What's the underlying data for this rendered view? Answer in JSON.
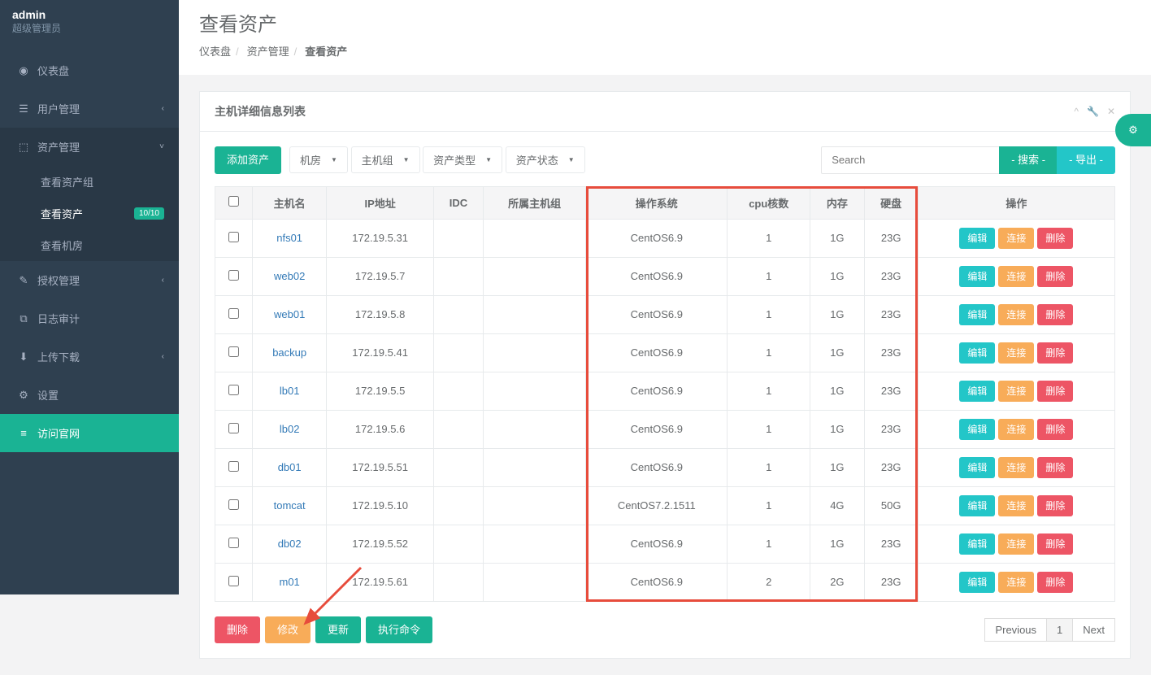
{
  "profile": {
    "name": "admin",
    "role": "超级管理员"
  },
  "sidebar": [
    {
      "icon": "◉",
      "label": "仪表盘",
      "type": "link"
    },
    {
      "icon": "☰",
      "label": "用户管理",
      "type": "menu",
      "caret": "‹"
    },
    {
      "icon": "⬚",
      "label": "资产管理",
      "type": "menu",
      "open": true,
      "caret": "˅",
      "sub": [
        {
          "label": "查看资产组"
        },
        {
          "label": "查看资产",
          "active": true,
          "badge": "10/10"
        },
        {
          "label": "查看机房"
        }
      ]
    },
    {
      "icon": "✎",
      "label": "授权管理",
      "type": "menu",
      "caret": "‹"
    },
    {
      "icon": "⧉",
      "label": "日志审计",
      "type": "link"
    },
    {
      "icon": "⬇",
      "label": "上传下载",
      "type": "menu",
      "caret": "‹"
    },
    {
      "icon": "⚙",
      "label": "设置",
      "type": "link"
    },
    {
      "icon": "≡",
      "label": "访问官网",
      "type": "link",
      "highlight": true
    }
  ],
  "page": {
    "title": "查看资产",
    "breadcrumb": [
      "仪表盘",
      "资产管理",
      "查看资产"
    ]
  },
  "panel": {
    "title": "主机详细信息列表",
    "tools": {
      "collapse": "^",
      "wrench": "🔧",
      "close": "✕"
    }
  },
  "toolbar": {
    "add": "添加资产",
    "filters": [
      "机房",
      "主机组",
      "资产类型",
      "资产状态"
    ],
    "search_placeholder": "Search",
    "search_btn": "- 搜索 -",
    "export_btn": "- 导出 -"
  },
  "table": {
    "headers": [
      "",
      "主机名",
      "IP地址",
      "IDC",
      "所属主机组",
      "操作系统",
      "cpu核数",
      "内存",
      "硬盘",
      "操作"
    ],
    "rows": [
      {
        "host": "nfs01",
        "ip": "172.19.5.31",
        "idc": "",
        "group": "",
        "os": "CentOS6.9",
        "cpu": "1",
        "mem": "1G",
        "disk": "23G"
      },
      {
        "host": "web02",
        "ip": "172.19.5.7",
        "idc": "",
        "group": "",
        "os": "CentOS6.9",
        "cpu": "1",
        "mem": "1G",
        "disk": "23G"
      },
      {
        "host": "web01",
        "ip": "172.19.5.8",
        "idc": "",
        "group": "",
        "os": "CentOS6.9",
        "cpu": "1",
        "mem": "1G",
        "disk": "23G"
      },
      {
        "host": "backup",
        "ip": "172.19.5.41",
        "idc": "",
        "group": "",
        "os": "CentOS6.9",
        "cpu": "1",
        "mem": "1G",
        "disk": "23G"
      },
      {
        "host": "lb01",
        "ip": "172.19.5.5",
        "idc": "",
        "group": "",
        "os": "CentOS6.9",
        "cpu": "1",
        "mem": "1G",
        "disk": "23G"
      },
      {
        "host": "lb02",
        "ip": "172.19.5.6",
        "idc": "",
        "group": "",
        "os": "CentOS6.9",
        "cpu": "1",
        "mem": "1G",
        "disk": "23G"
      },
      {
        "host": "db01",
        "ip": "172.19.5.51",
        "idc": "",
        "group": "",
        "os": "CentOS6.9",
        "cpu": "1",
        "mem": "1G",
        "disk": "23G"
      },
      {
        "host": "tomcat",
        "ip": "172.19.5.10",
        "idc": "",
        "group": "",
        "os": "CentOS7.2.1511",
        "cpu": "1",
        "mem": "4G",
        "disk": "50G"
      },
      {
        "host": "db02",
        "ip": "172.19.5.52",
        "idc": "",
        "group": "",
        "os": "CentOS6.9",
        "cpu": "1",
        "mem": "1G",
        "disk": "23G"
      },
      {
        "host": "m01",
        "ip": "172.19.5.61",
        "idc": "",
        "group": "",
        "os": "CentOS6.9",
        "cpu": "2",
        "mem": "2G",
        "disk": "23G"
      }
    ],
    "row_actions": {
      "edit": "编辑",
      "connect": "连接",
      "delete": "删除"
    }
  },
  "footer_actions": {
    "delete": "删除",
    "modify": "修改",
    "update": "更新",
    "exec": "执行命令"
  },
  "pagination": {
    "prev": "Previous",
    "pages": [
      "1"
    ],
    "next": "Next"
  },
  "colors": {
    "primary": "#1ab394",
    "info": "#23c6c8",
    "warning": "#f8ac59",
    "danger": "#ed5565",
    "highlight": "#e74c3c"
  }
}
